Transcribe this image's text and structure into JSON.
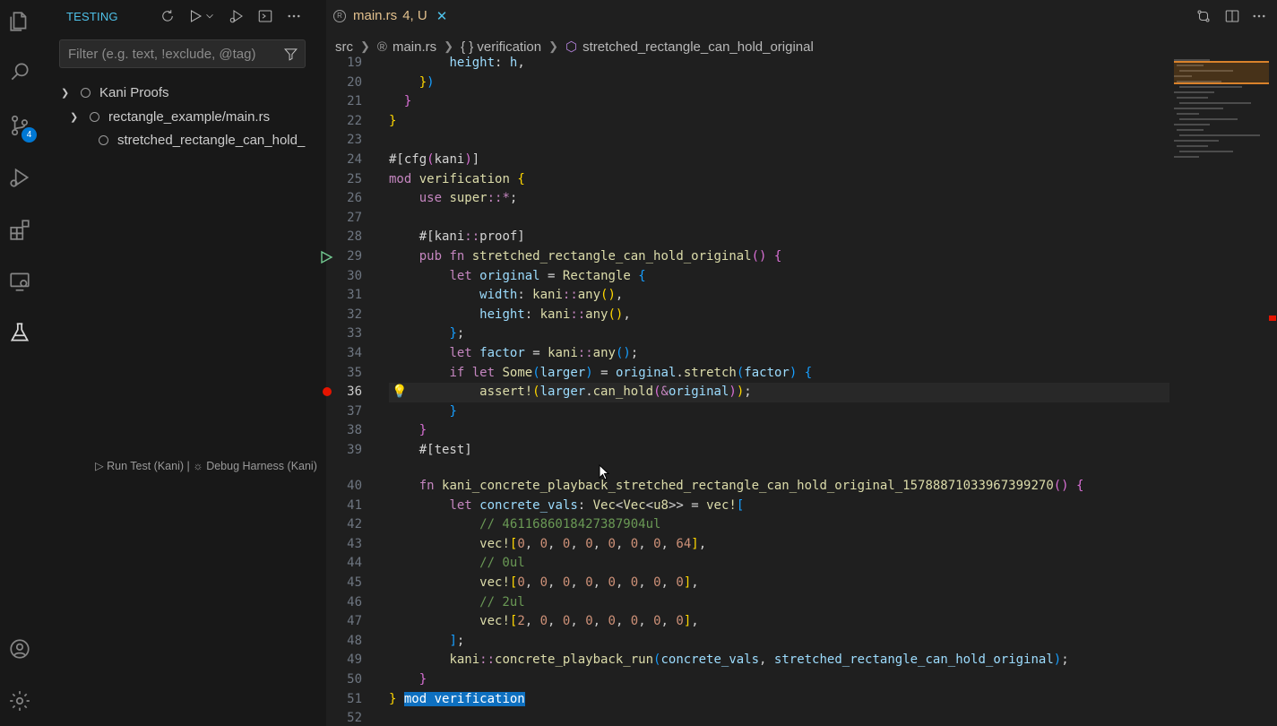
{
  "sidebar": {
    "title": "TESTING",
    "filter_placeholder": "Filter (e.g. text, !exclude, @tag)",
    "tree": [
      {
        "label": "Kani Proofs",
        "level": 0
      },
      {
        "label": "rectangle_example/main.rs",
        "level": 1
      },
      {
        "label": "stretched_rectangle_can_hold_",
        "level": 2
      }
    ]
  },
  "activity_bar": {
    "source_control_badge": "4",
    "icons": [
      "files-icon",
      "search-icon",
      "source-control-icon",
      "run-debug-icon",
      "extensions-icon",
      "remote-explorer-icon",
      "testing-icon",
      "account-icon",
      "settings-gear-icon"
    ]
  },
  "tab": {
    "filename": "main.rs",
    "status": "4, U"
  },
  "breadcrumb": {
    "src": "src",
    "file": "main.rs",
    "module": "{ } verification",
    "symbol": "stretched_rectangle_can_hold_original"
  },
  "codelens": {
    "run": "Run Test (Kani)",
    "sep": "|",
    "debug": "Debug Harness (Kani)"
  },
  "line_numbers": [
    "19",
    "20",
    "21",
    "22",
    "23",
    "24",
    "25",
    "26",
    "27",
    "28",
    "29",
    "30",
    "31",
    "32",
    "33",
    "34",
    "35",
    "36",
    "37",
    "38",
    "39",
    "40",
    "41",
    "42",
    "43",
    "44",
    "45",
    "46",
    "47",
    "48",
    "49",
    "50",
    "51",
    "52"
  ],
  "code": {
    "l19": "            height: h,",
    "l42": "            // 4611686018427387904ul",
    "l44": "            // 0ul",
    "l46": "            // 2ul",
    "mod_verification": "mod verification"
  },
  "colors": {
    "accent": "#4fc1e9",
    "badge": "#0078d4",
    "breakpoint": "#e51400",
    "modified_tab": "#e2c08d"
  }
}
